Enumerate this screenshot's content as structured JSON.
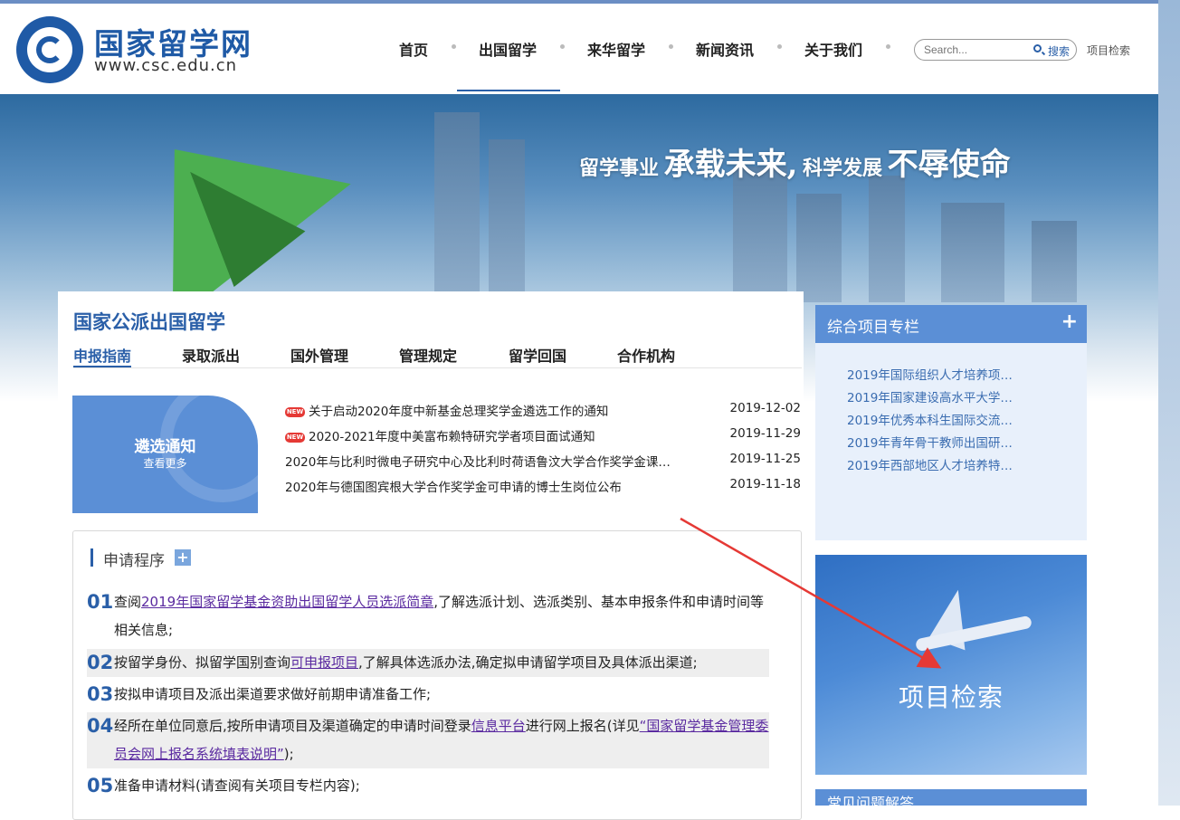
{
  "header": {
    "logo_title": "国家留学网",
    "logo_url": "www.csc.edu.cn",
    "nav": [
      "首页",
      "出国留学",
      "来华留学",
      "新闻资讯",
      "关于我们"
    ],
    "search_placeholder": "Search...",
    "search_button": "搜索",
    "project_search_link": "项目检索"
  },
  "banner": {
    "slogan_a": "留学事业",
    "slogan_b": "承载未来,",
    "slogan_c": "科学发展",
    "slogan_d": "不辱使命"
  },
  "main": {
    "section_title": "国家公派出国留学",
    "tabs": [
      "申报指南",
      "录取派出",
      "国外管理",
      "管理规定",
      "留学回国",
      "合作机构"
    ],
    "notice_tile": {
      "title": "遴选通知",
      "more": "查看更多"
    },
    "new_badge": "NEW",
    "news": [
      {
        "title": "关于启动2020年度中新基金总理奖学金遴选工作的通知",
        "date": "2019-12-02",
        "is_new": true
      },
      {
        "title": "2020-2021年度中美富布赖特研究学者项目面试通知",
        "date": "2019-11-29",
        "is_new": true
      },
      {
        "title": "2020年与比利时微电子研究中心及比利时荷语鲁汶大学合作奖学金课…",
        "date": "2019-11-25",
        "is_new": false
      },
      {
        "title": "2020年与德国图宾根大学合作奖学金可申请的博士生岗位公布",
        "date": "2019-11-18",
        "is_new": false
      }
    ],
    "process": {
      "title": "申请程序",
      "plus": "+",
      "steps": [
        {
          "num": "01",
          "pre": "查阅",
          "link": "2019年国家留学基金资助出国留学人员选派简章",
          "post": ",了解选派计划、选派类别、基本申报条件和申请时间等相关信息;"
        },
        {
          "num": "02",
          "pre": "按留学身份、拟留学国别查询",
          "link": "可申报项目",
          "post": ",了解具体选派办法,确定拟申请留学项目及具体派出渠道;"
        },
        {
          "num": "03",
          "pre": "按拟申请项目及派出渠道要求做好前期申请准备工作;",
          "link": "",
          "post": ""
        },
        {
          "num": "04",
          "pre": "经所在单位同意后,按所申请项目及渠道确定的申请时间登录",
          "link": "信息平台",
          "post": "进行网上报名(详见",
          "link2": "“国家留学基金管理委员会网上报名系统填表说明”",
          "post2": ");"
        },
        {
          "num": "05",
          "pre": "准备申请材料(请查阅有关项目专栏内容);",
          "link": "",
          "post": ""
        }
      ]
    }
  },
  "sidebar": {
    "column_title": "综合项目专栏",
    "column_plus": "+",
    "links": [
      "2019年国际组织人才培养项…",
      "2019年国家建设高水平大学…",
      "2019年优秀本科生国际交流…",
      "2019年青年骨干教师出国研…",
      "2019年西部地区人才培养特…"
    ],
    "project_search_tile": "项目检索",
    "bottom_title": "常见问题解答"
  },
  "colors": {
    "brand_blue": "#2a5fa8",
    "tile_blue": "#5b8fd6",
    "arrow_red": "#e53935"
  }
}
